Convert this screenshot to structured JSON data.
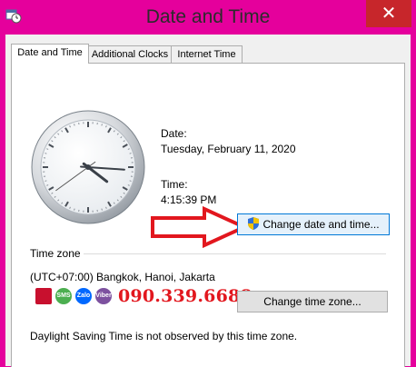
{
  "window": {
    "title": "Date and Time",
    "close_glyph": "✕"
  },
  "tabs": [
    {
      "label": "Date and Time",
      "active": true
    },
    {
      "label": "Additional Clocks",
      "active": false
    },
    {
      "label": "Internet Time",
      "active": false
    }
  ],
  "date": {
    "label": "Date:",
    "value": "Tuesday, February 11, 2020"
  },
  "time": {
    "label": "Time:",
    "value": "4:15:39 PM",
    "clock_hands": {
      "hour": 4,
      "minute": 15,
      "second": 39
    }
  },
  "buttons": {
    "change_datetime": "Change date and time...",
    "change_timezone": "Change time zone..."
  },
  "timezone": {
    "heading": "Time zone",
    "value": "(UTC+07:00) Bangkok, Hanoi, Jakarta"
  },
  "dst_note": "Daylight Saving Time is not observed by this time zone.",
  "overlay": {
    "phone": "090.339.6688",
    "app_icons": [
      {
        "name": "flag",
        "color": "#c8102e"
      },
      {
        "name": "sms",
        "color": "#4caf50",
        "text": "SMS"
      },
      {
        "name": "zalo",
        "color": "#0068ff",
        "text": "Zalo"
      },
      {
        "name": "viber",
        "color": "#7d519f",
        "text": "Viber"
      }
    ],
    "arrow_color": "#e2171e"
  },
  "colors": {
    "titlebar": "#e5009c",
    "close": "#c7262b",
    "focus_border": "#0078d7"
  }
}
